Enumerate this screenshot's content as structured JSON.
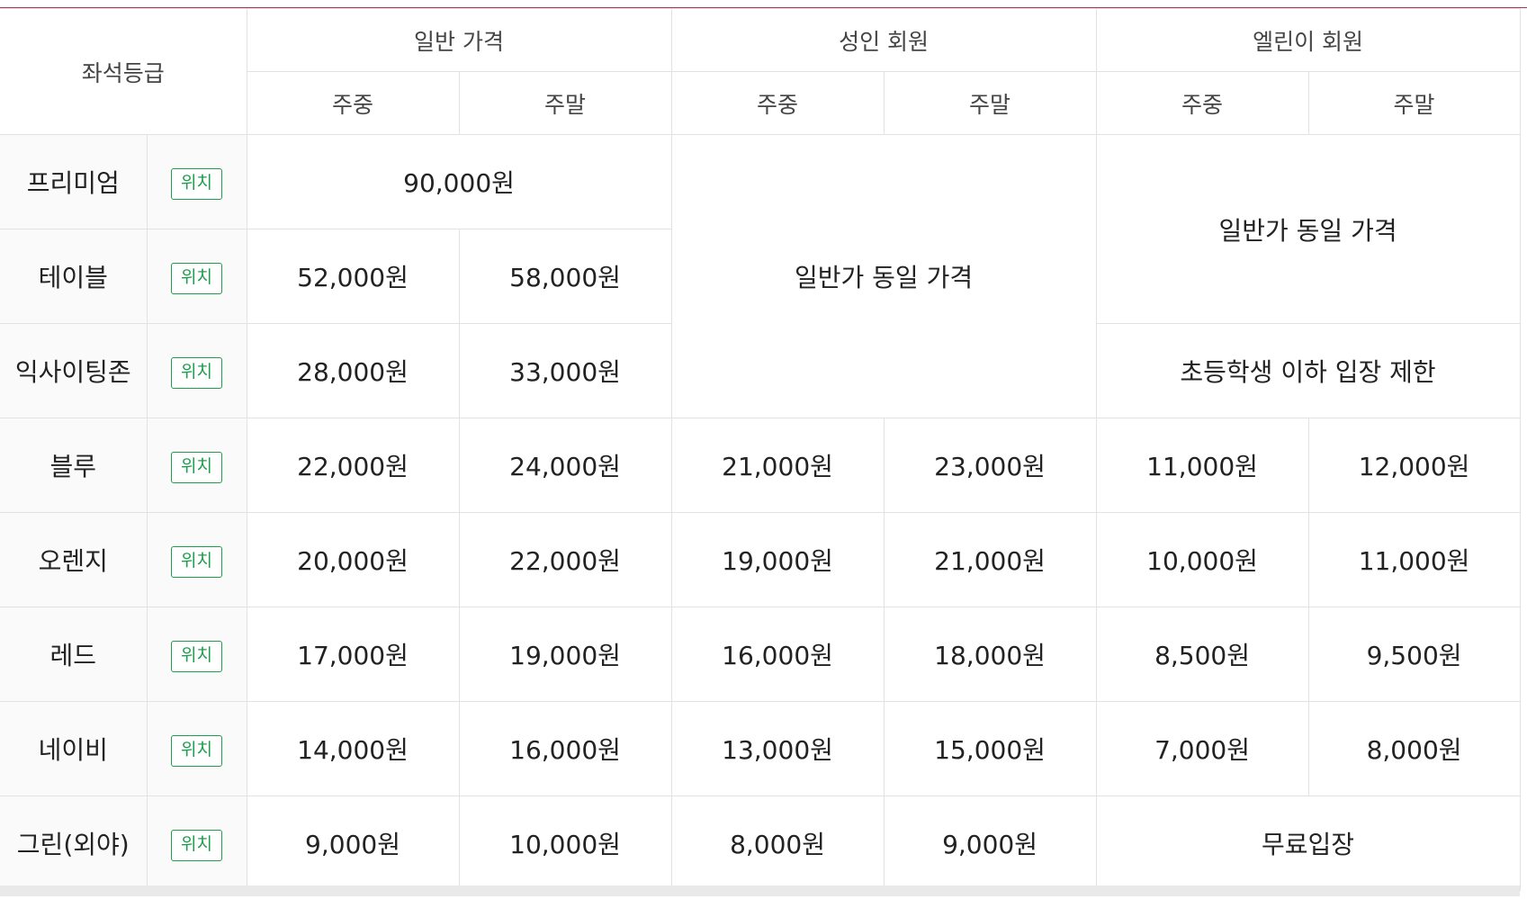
{
  "table": {
    "seat_header": "좌석등급",
    "groups": [
      "일반 가격",
      "성인 회원",
      "엘린이 회원"
    ],
    "subheaders": [
      "주중",
      "주말",
      "주중",
      "주말",
      "주중",
      "주말"
    ],
    "location_label": "위치",
    "rows": [
      {
        "grade": "프리미엄",
        "general_merged": "90,000원"
      },
      {
        "grade": "테이블",
        "general": [
          "52,000원",
          "58,000원"
        ]
      },
      {
        "grade": "익사이팅존",
        "general": [
          "28,000원",
          "33,000원"
        ]
      },
      {
        "grade": "블루",
        "general": [
          "22,000원",
          "24,000원"
        ],
        "adult": [
          "21,000원",
          "23,000원"
        ],
        "kid": [
          "11,000원",
          "12,000원"
        ]
      },
      {
        "grade": "오렌지",
        "general": [
          "20,000원",
          "22,000원"
        ],
        "adult": [
          "19,000원",
          "21,000원"
        ],
        "kid": [
          "10,000원",
          "11,000원"
        ]
      },
      {
        "grade": "레드",
        "general": [
          "17,000원",
          "19,000원"
        ],
        "adult": [
          "16,000원",
          "18,000원"
        ],
        "kid": [
          "8,500원",
          "9,500원"
        ]
      },
      {
        "grade": "네이비",
        "general": [
          "14,000원",
          "16,000원"
        ],
        "adult": [
          "13,000원",
          "15,000원"
        ],
        "kid": [
          "7,000원",
          "8,000원"
        ]
      },
      {
        "grade": "그린(외야)",
        "general": [
          "9,000원",
          "10,000원"
        ],
        "adult": [
          "8,000원",
          "9,000원"
        ],
        "kid_merged": "무료입장"
      }
    ],
    "adult_same_price_note": "일반가 동일 가격",
    "kid_same_price_note": "일반가 동일 가격",
    "kid_restriction_note": "초등학생 이하 입장 제한"
  },
  "colors": {
    "accent_line": "#a8345e",
    "location_button": "#1e9d4c",
    "border": "#e2e2e2",
    "label_bg": "#fafafa"
  }
}
